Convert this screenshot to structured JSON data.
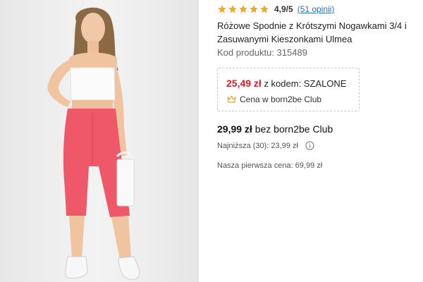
{
  "product_image": {
    "icon": "product-photo"
  },
  "rating": {
    "stars_filled": 5,
    "stars_total": 5,
    "star_color": "#f5a623",
    "value": "4,9/5",
    "reviews_link": "(51 opinii)"
  },
  "product": {
    "title": "Różowe Spodnie z Krótszymi Nogawkami 3/4 i Zasuwanymi Kieszonkami Ulmea",
    "code_text": "Kod produktu: 315489"
  },
  "promo": {
    "price": "25,49 zł",
    "code_text": " z kodem: SZALONE",
    "price_color": "#d5202f",
    "club_icon": "crown-icon",
    "club_text": "Cena w born2be Club"
  },
  "pricing": {
    "regular_price": "29,99 zł",
    "regular_suffix": " bez born2be Club",
    "lowest_text": "Najniższa (30): 23,99 zł",
    "info_icon": "info-icon",
    "first_price_text": "Nasza pierwsza cena: 69,99 zł"
  }
}
